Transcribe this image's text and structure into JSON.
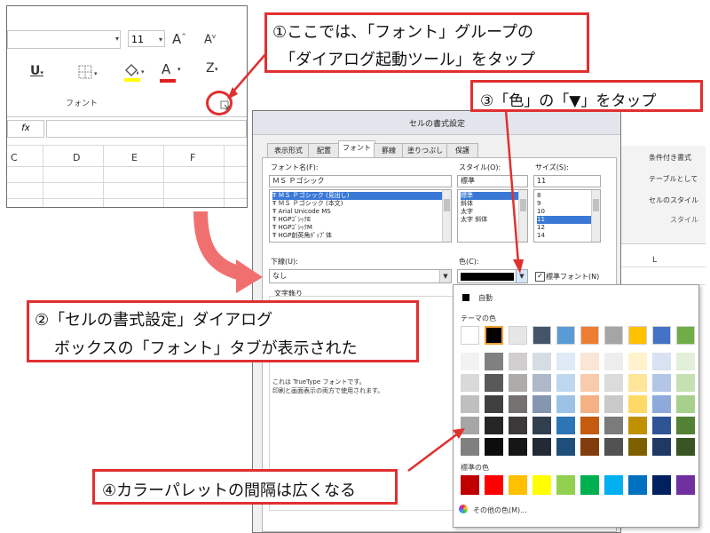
{
  "ribbon": {
    "font_size": "11",
    "grow_font_label": "A",
    "shrink_font_label": "A",
    "underline_label": "U",
    "font_color_label": "A",
    "clear_format_label": "Z",
    "group_label": "フォント",
    "formula_fx": "fx",
    "columns": [
      "C",
      "D",
      "E",
      "F"
    ]
  },
  "dialog": {
    "title": "セルの書式設定",
    "tabs": [
      "表示形式",
      "配置",
      "フォント",
      "罫線",
      "塗りつぶし",
      "保護"
    ],
    "active_tab": "フォント",
    "font_name_label": "フォント名(F):",
    "font_name_value": "ＭＳ Ｐゴシック",
    "font_list": [
      "ＭＳ Ｐゴシック (見出し)",
      "ＭＳ Ｐゴシック (本文)",
      "Arial Unicode MS",
      "HGPｺﾞｼｯｸE",
      "HGPｺﾞｼｯｸM",
      "HGP創英角ﾎﾟｯﾌﾟ体"
    ],
    "style_label": "スタイル(O):",
    "style_value": "標準",
    "style_list": [
      "標準",
      "斜体",
      "太字",
      "太字 斜体"
    ],
    "size_label": "サイズ(S):",
    "size_value": "11",
    "size_list": [
      "8",
      "9",
      "10",
      "11",
      "12",
      "14"
    ],
    "underline_label": "下線(U):",
    "underline_value": "なし",
    "color_label": "色(C):",
    "standard_font_label": "標準フォント(N)",
    "effects_label": "文字飾り",
    "info_line1": "これは TrueType フォントです。",
    "info_line2": "印刷と画面表示の両方で使用されます。"
  },
  "palette": {
    "auto_label": "自動",
    "theme_label": "テーマの色",
    "standard_label": "標準の色",
    "more_label": "その他の色(M)...",
    "theme_colors": [
      "#ffffff",
      "#000000",
      "#e7e6e6",
      "#44546a",
      "#5b9bd5",
      "#ed7d31",
      "#a5a5a5",
      "#ffc000",
      "#4472c4",
      "#70ad47"
    ],
    "theme_shades": [
      [
        "#f2f2f2",
        "#808080",
        "#d0cece",
        "#d6dce4",
        "#deebf6",
        "#fbe5d5",
        "#ededed",
        "#fff2cc",
        "#d9e2f3",
        "#e2efd9"
      ],
      [
        "#d9d9d9",
        "#595959",
        "#aeabab",
        "#adb9ca",
        "#bdd7ee",
        "#f7cbac",
        "#dbdbdb",
        "#fee599",
        "#b4c6e7",
        "#c5e0b3"
      ],
      [
        "#bfbfbf",
        "#404040",
        "#757171",
        "#8496b0",
        "#9cc3e5",
        "#f4b183",
        "#c9c9c9",
        "#ffd965",
        "#8eaadb",
        "#a8d08d"
      ],
      [
        "#a6a6a6",
        "#262626",
        "#3a3838",
        "#323f4f",
        "#2e75b5",
        "#c55a11",
        "#7b7b7b",
        "#bf9000",
        "#2f5496",
        "#538135"
      ],
      [
        "#808080",
        "#0d0d0d",
        "#171616",
        "#222a35",
        "#1e4e79",
        "#833c0b",
        "#525252",
        "#7f6000",
        "#1f3864",
        "#375623"
      ]
    ],
    "standard_colors": [
      "#c00000",
      "#ff0000",
      "#ffc000",
      "#ffff00",
      "#92d050",
      "#00b050",
      "#00b0f0",
      "#0070c0",
      "#002060",
      "#7030a0"
    ]
  },
  "callouts": {
    "c1_line1": "①ここでは、「フォント」グループの",
    "c1_line2": "「ダイアログ起動ツール」をタップ",
    "c2_line1": "②「セルの書式設定」ダイアログ",
    "c2_line2": "ボックスの「フォント」タブが表示された",
    "c3": "③「色」の「▼」をタップ",
    "c4": "④カラーパレットの間隔は広くなる"
  },
  "background_excel": {
    "items": [
      "条件付き書式",
      "テーブルとして",
      "セルのスタイル",
      "スタイル"
    ],
    "col": "L"
  },
  "colors": {
    "callout_red": "#e03030",
    "arrow_salmon": "#f07070",
    "selection_blue": "#3a78d6"
  }
}
